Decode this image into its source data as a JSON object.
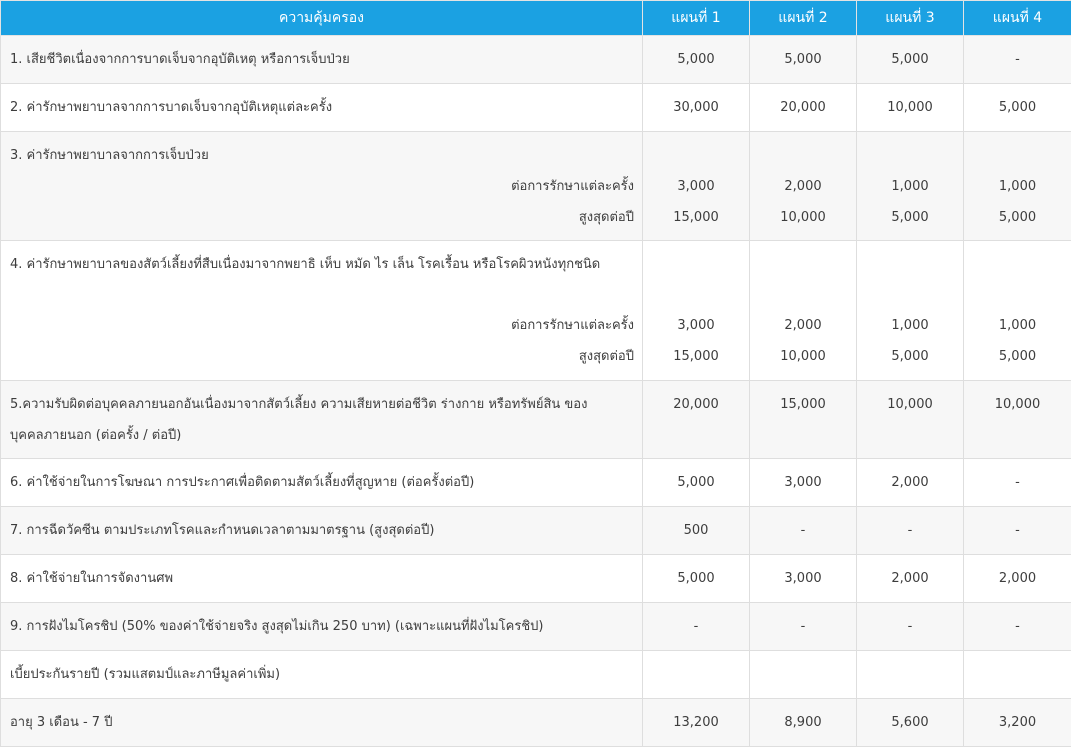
{
  "header": {
    "coverage": "ความคุ้มครอง",
    "plans": [
      "แผนที่ 1",
      "แผนที่ 2",
      "แผนที่ 3",
      "แผนที่ 4"
    ]
  },
  "rows": [
    {
      "label": "1. เสียชีวิตเนื่องจากการบาดเจ็บจากอุบัติเหตุ หรือการเจ็บป่วย",
      "values": [
        "5,000",
        "5,000",
        "5,000",
        "-"
      ]
    },
    {
      "label": "2. ค่ารักษาพยาบาลจากการบาดเจ็บจากอุบัติเหตุแต่ละครั้ง",
      "values": [
        "30,000",
        "20,000",
        "10,000",
        "5,000"
      ]
    },
    {
      "label": "3. ค่ารักษาพยาบาลจากการเจ็บป่วย",
      "sub": [
        {
          "label": "ต่อการรักษาแต่ละครั้ง",
          "values": [
            "3,000",
            "2,000",
            "1,000",
            "1,000"
          ]
        },
        {
          "label": "สูงสุดต่อปี",
          "values": [
            "15,000",
            "10,000",
            "5,000",
            "5,000"
          ]
        }
      ]
    },
    {
      "label": "4. ค่ารักษาพยาบาลของสัตว์เลี้ยงที่สืบเนื่องมาจากพยาธิ เห็บ หมัด ไร เล็น โรคเรื้อน หรือโรคผิวหนังทุกชนิด",
      "sub": [
        {
          "label": "ต่อการรักษาแต่ละครั้ง",
          "values": [
            "3,000",
            "2,000",
            "1,000",
            "1,000"
          ]
        },
        {
          "label": "สูงสุดต่อปี",
          "values": [
            "15,000",
            "10,000",
            "5,000",
            "5,000"
          ]
        }
      ]
    },
    {
      "label": "5.ความรับผิดต่อบุคคลภายนอกอันเนื่องมาจากสัตว์เลี้ยง ความเสียหายต่อชีวิต ร่างกาย หรือทรัพย์สิน ของ",
      "label2": "บุคคลภายนอก (ต่อครั้ง / ต่อปี)",
      "values": [
        "20,000",
        "15,000",
        "10,000",
        "10,000"
      ]
    },
    {
      "label": "6. ค่าใช้จ่ายในการโฆษณา การประกาศเพื่อติดตามสัตว์เลี้ยงที่สูญหาย (ต่อครั้งต่อปี)",
      "values": [
        "5,000",
        "3,000",
        "2,000",
        "-"
      ]
    },
    {
      "label": "7. การฉีดวัคซีน ตามประเภทโรคและกำหนดเวลาตามมาตรฐาน (สูงสุดต่อปี)",
      "values": [
        "500",
        "-",
        "-",
        "-"
      ]
    },
    {
      "label": "8. ค่าใช้จ่ายในการจัดงานศพ",
      "values": [
        "5,000",
        "3,000",
        "2,000",
        "2,000"
      ]
    },
    {
      "label": "9. การฝังไมโครชิป (50% ของค่าใช้จ่ายจริง สูงสุดไม่เกิน 250 บาท) (เฉพาะแผนที่ฝังไมโครชิป)",
      "values": [
        "-",
        "-",
        "-",
        "-"
      ]
    },
    {
      "label": "เบี้ยประกันรายปี (รวมแสตมป์และภาษีมูลค่าเพิ่ม)",
      "values": [
        "",
        "",
        "",
        ""
      ]
    },
    {
      "label": "อายุ 3 เดือน - 7 ปี",
      "values": [
        "13,200",
        "8,900",
        "5,600",
        "3,200"
      ]
    }
  ]
}
